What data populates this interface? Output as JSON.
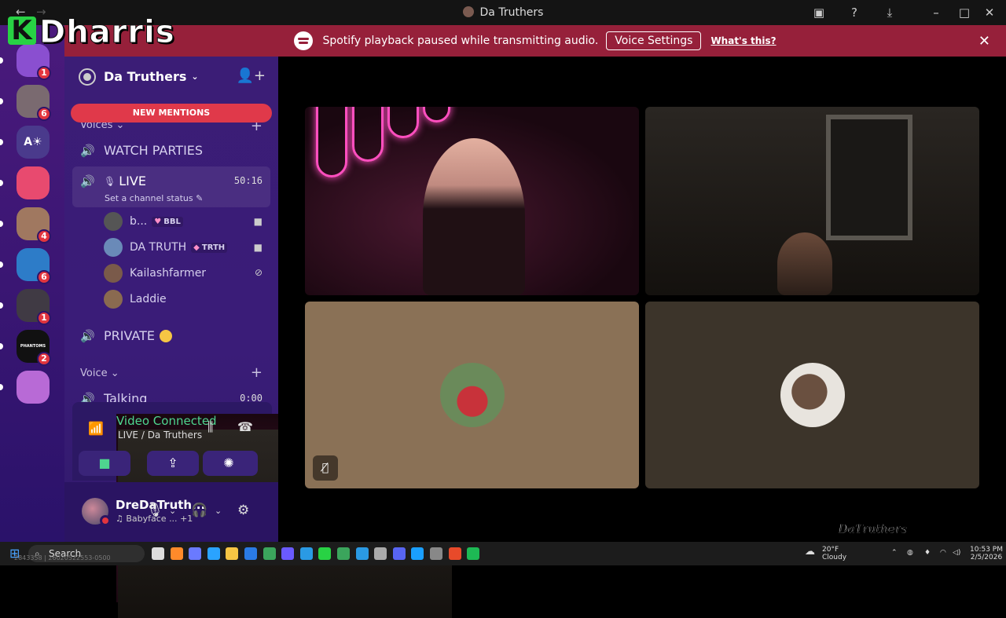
{
  "titlebar": {
    "title": "Da Truthers",
    "back": "←",
    "forward": "→"
  },
  "watermark": {
    "k": "K",
    "name": "Dharris"
  },
  "notice": {
    "message": "Spotify playback paused while transmitting audio.",
    "button": "Voice Settings",
    "link": "What's this?",
    "close": "✕"
  },
  "guilds": [
    {
      "badge": "1",
      "color": "#8a4fd0"
    },
    {
      "badge": "6",
      "color": "#7a6a70"
    },
    {
      "label": "A☀",
      "badge": "",
      "color": "#4a3a8c"
    },
    {
      "badge": "",
      "color": "#e84a6f"
    },
    {
      "badge": "4",
      "color": "#a07860"
    },
    {
      "badge": "6",
      "color": "#2d7cc8"
    },
    {
      "badge": "1",
      "color": "#403a44"
    },
    {
      "label": "PHANTOMS",
      "badge": "2",
      "color": "#111111"
    },
    {
      "badge": "",
      "color": "#b86ad6"
    }
  ],
  "sidebar": {
    "server_name": "Da Truthers",
    "mentions": "NEW MENTIONS",
    "cat_voices": "Voices",
    "watch_parties": "WATCH PARTIES",
    "live": {
      "name": "LIVE",
      "timer": "50:16",
      "status": "Set a channel status"
    },
    "users": [
      {
        "name": "b...",
        "tag": "BBL",
        "tag_icon": "♥"
      },
      {
        "name": "DA TRUTH",
        "tag": "TRTH",
        "tag_icon": "◆"
      },
      {
        "name": "Kailashfarmer",
        "tag": ""
      },
      {
        "name": "Laddie",
        "tag": ""
      }
    ],
    "private": "PRIVATE",
    "cat_voice": "Voice",
    "talking": {
      "name": "Talking",
      "timer": "0:00"
    }
  },
  "voice_conn": {
    "title": "Video Connected",
    "sub": "LIVE / Da Truthers"
  },
  "userbar": {
    "name": "DreDaTruth...",
    "status": "Babyface ...",
    "extra": "+1"
  },
  "stage": {
    "logo": "DaTruthers"
  },
  "taskbar": {
    "search": "Search",
    "weather_temp": "20°F",
    "weather_desc": "Cloudy",
    "time": "10:53 PM",
    "date": "2/5/2026"
  },
  "tiny_text": "2843358 | 26020522553-0500"
}
